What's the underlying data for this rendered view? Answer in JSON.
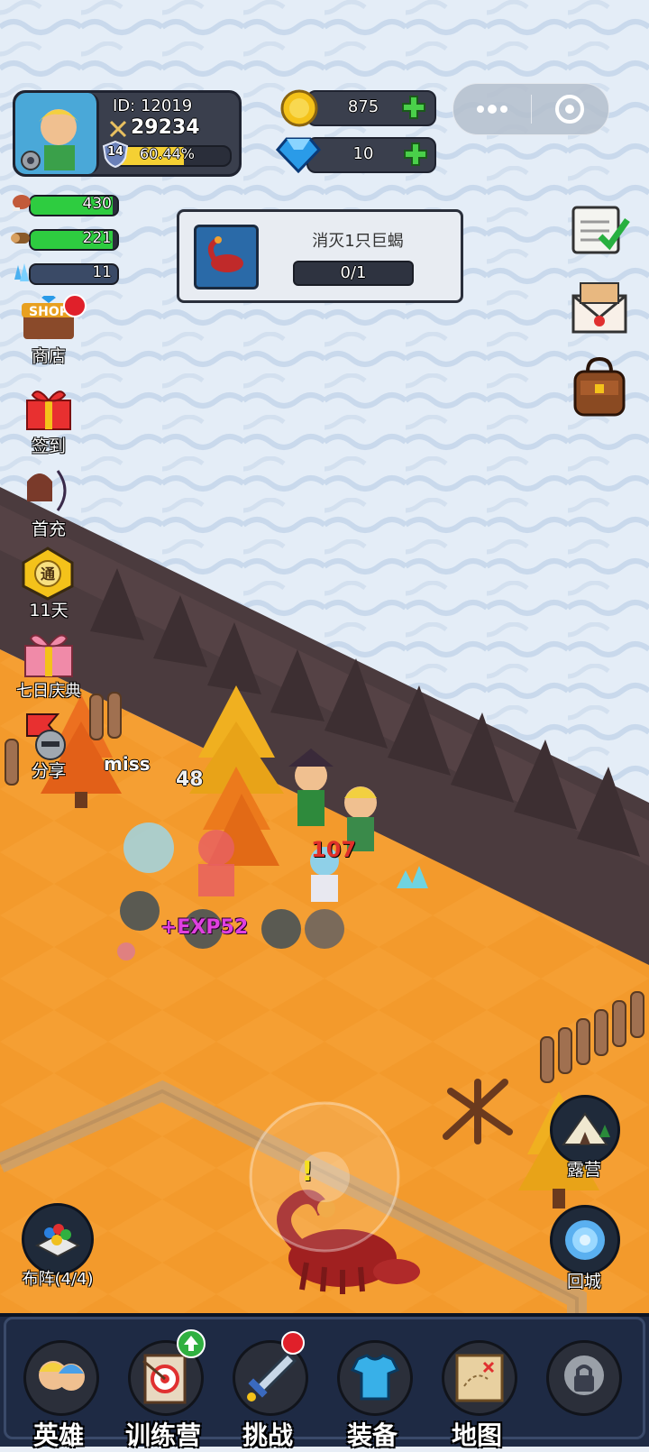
{
  "player": {
    "id_label": "ID: 12019",
    "power": "29234",
    "level": "14",
    "exp_percent": "60.44%",
    "exp_fraction": 0.6044
  },
  "currency": {
    "gold": "875",
    "gems": "10"
  },
  "resources": [
    {
      "icon": "meat-icon",
      "value": "430",
      "color": "#2ecc40",
      "fill": 0.95
    },
    {
      "icon": "wood-icon",
      "value": "221",
      "color": "#2ecc40",
      "fill": 0.95
    },
    {
      "icon": "crystal-icon",
      "value": "11",
      "color": "#4a6a9a",
      "fill": 0.0
    }
  ],
  "quest": {
    "title": "消灭1只巨蝎",
    "progress": "0/1"
  },
  "left_menu": [
    {
      "name": "shop",
      "label": "商店",
      "badge": true
    },
    {
      "name": "checkin",
      "label": "签到",
      "badge": false
    },
    {
      "name": "first-recharge",
      "label": "首充",
      "badge": false
    },
    {
      "name": "pass",
      "label": "11天",
      "badge": false
    },
    {
      "name": "seven-day",
      "label": "七日庆典",
      "badge": false
    },
    {
      "name": "share",
      "label": "分享",
      "badge": false
    }
  ],
  "right_menu": [
    {
      "name": "tasks",
      "icon": "checklist-icon"
    },
    {
      "name": "mail",
      "icon": "mail-icon"
    },
    {
      "name": "bag",
      "icon": "backpack-icon"
    }
  ],
  "world_buttons": {
    "camp": "露营",
    "return_city": "回城",
    "formation": "布阵(4/4)"
  },
  "floating": {
    "miss": "miss",
    "damage1": "48",
    "damage2": "107",
    "exp": "+EXP52"
  },
  "quest_marker": "!",
  "bottom_nav": [
    {
      "name": "heroes",
      "label": "英雄",
      "badge": null
    },
    {
      "name": "training",
      "label": "训练营",
      "badge": "up"
    },
    {
      "name": "challenge",
      "label": "挑战",
      "badge": "red"
    },
    {
      "name": "equipment",
      "label": "装备",
      "badge": null
    },
    {
      "name": "map",
      "label": "地图",
      "badge": null
    },
    {
      "name": "locked",
      "label": "",
      "badge": null
    }
  ],
  "colors": {
    "snow": "#e6eef7",
    "cliff": "#4a3a3c",
    "ground": "#f39a2c",
    "exp_bar": "#f5d033",
    "resource_bar": "#2ecc40",
    "nav_bg": "#1e2a44"
  }
}
